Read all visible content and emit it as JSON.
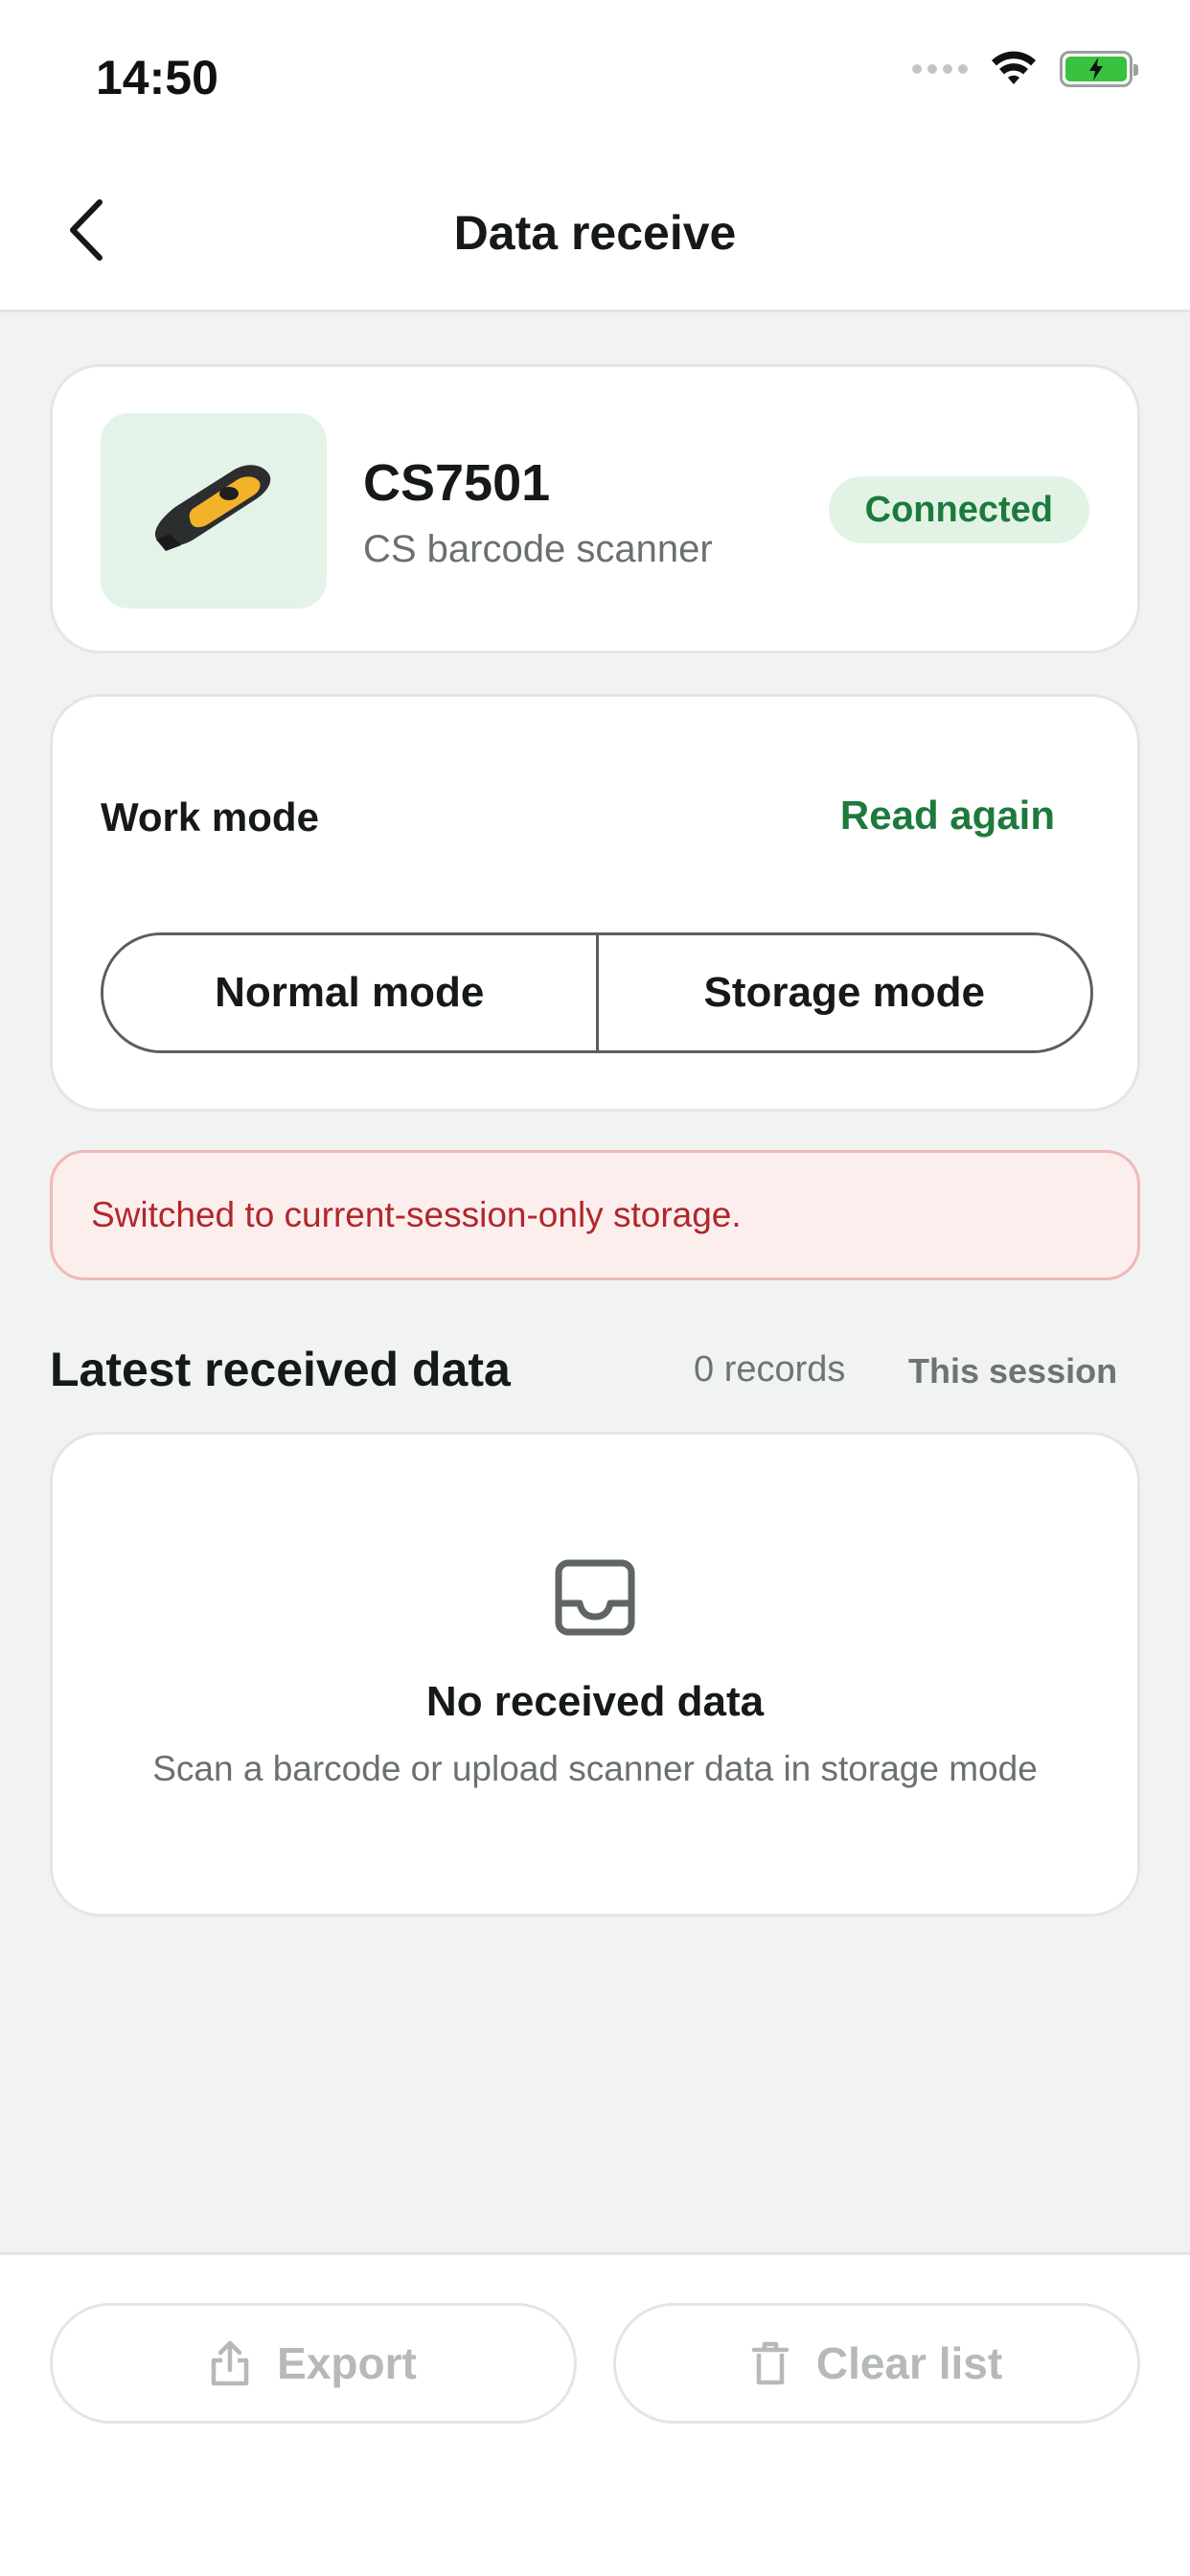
{
  "status_bar": {
    "time": "14:50"
  },
  "nav": {
    "title": "Data receive"
  },
  "device": {
    "name": "CS7501",
    "type": "CS barcode scanner",
    "status": "Connected"
  },
  "work_mode": {
    "label": "Work mode",
    "read_again": "Read again",
    "options": [
      "Normal mode",
      "Storage mode"
    ]
  },
  "alert": {
    "message": "Switched to current-session-only storage."
  },
  "received": {
    "title": "Latest received data",
    "count": "0 records",
    "scope": "This session",
    "empty_title": "No received data",
    "empty_subtitle": "Scan a barcode or upload scanner data in storage mode"
  },
  "actions": {
    "export": "Export",
    "clear": "Clear list"
  },
  "colors": {
    "accent": "#1d7a3c",
    "badge_bg": "#e2f3e6",
    "alert_bg": "#fdeeee",
    "alert_text": "#b0272b",
    "disabled_text": "#b5bab7"
  },
  "icons": {
    "back": "chevron-left-icon",
    "device": "barcode-scanner-icon",
    "empty": "inbox-tray-icon",
    "export": "share-upload-icon",
    "clear": "trash-icon"
  }
}
